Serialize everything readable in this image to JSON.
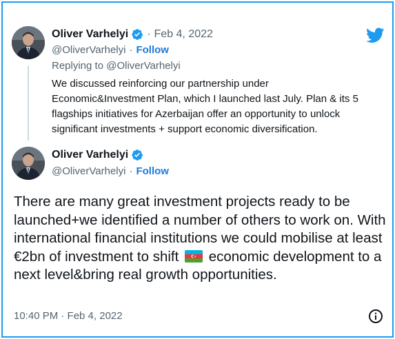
{
  "tweet1": {
    "author_name": "Oliver Varhelyi",
    "date": "Feb 4, 2022",
    "separator": "·",
    "handle": "@OliverVarhelyi",
    "follow_label": "Follow",
    "replying_to_prefix": "Replying to",
    "replying_to_handle": "@OliverVarhelyi",
    "text": "We discussed reinforcing our partnership under Economic&Investment Plan, which I launched last July. Plan & its 5 flagships initiatives for Azerbaijan offer an opportunity to unlock significant investments + support economic diversification."
  },
  "tweet2": {
    "author_name": "Oliver Varhelyi",
    "handle": "@OliverVarhelyi",
    "separator": "·",
    "follow_label": "Follow",
    "text_before_flag": "There are many great investment projects ready to be launched+we identified a number of others to work on. With international financial institutions we could mobilise at least €2bn of investment to shift",
    "text_after_flag": "economic development to a next level&bring real growth opportunities.",
    "timestamp": "10:40 PM · Feb 4, 2022"
  },
  "icons": {
    "brand": "twitter-bird-icon",
    "verified": "verified-badge-icon",
    "info": "info-icon",
    "flag": "azerbaijan-flag-icon"
  },
  "colors": {
    "accent": "#1d9bf0",
    "follow": "#1d7ad8",
    "secondary_text": "#536471",
    "text": "#0f1419",
    "flag_blue": "#00b5e2",
    "flag_red": "#ef3340",
    "flag_green": "#509e2f"
  }
}
